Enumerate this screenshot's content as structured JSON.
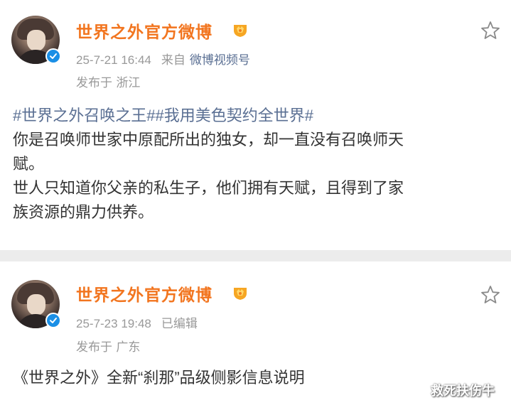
{
  "posts": [
    {
      "author": "世界之外官方微博",
      "time": "25-7-21 16:44",
      "source_prefix": "来自",
      "source": "微博视频号",
      "location": "发布于 浙江",
      "hashtags": "#世界之外召唤之王##我用美色契约全世界#",
      "text": [
        "你是召唤师世家中原配所出的独女，却一直没有召唤师天",
        "赋。",
        "世人只知道你父亲的私生子，他们拥有天赋，且得到了家",
        "族资源的鼎力供养。"
      ]
    },
    {
      "author": "世界之外官方微博",
      "time": "25-7-23 19:48",
      "edited": "已编辑",
      "location": "发布于 广东",
      "text": [
        "《世界之外》全新“刹那”品级侧影信息说明"
      ]
    }
  ],
  "watermark": "救死扶伤牛",
  "colors": {
    "author_name": "#f2751f",
    "hashtag": "#5a6f93",
    "verified": "#1a8fe6",
    "meta": "#999999",
    "divider": "#ececec"
  },
  "icons": {
    "verified": "verified-check-icon",
    "badge": "gold-fan-badge-icon",
    "favorite": "star-icon"
  }
}
